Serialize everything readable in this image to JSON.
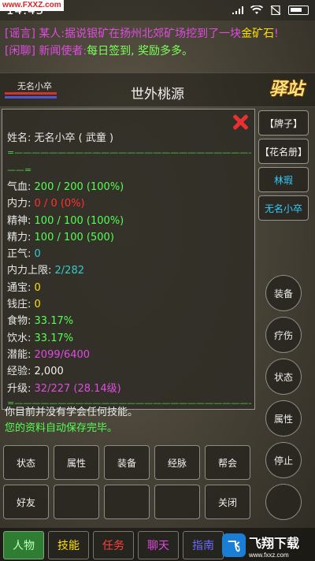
{
  "status_bar": {
    "time": "14:43",
    "watermark": "www.FXXZ.com"
  },
  "chat": [
    {
      "tag": "[谣言]",
      "sender": "某人:",
      "text": "据说银矿在扬州北郊矿场挖到了一块",
      "highlight": "金矿石",
      "end": "!"
    },
    {
      "tag": "[闲聊]",
      "sender": "新闻使者:",
      "text": "每日签到, 奖励多多。"
    }
  ],
  "header": {
    "player_name": "无名小卒",
    "location": "世外桃源",
    "inn_label": "驿站"
  },
  "panel": {
    "name_line": "姓名: 无名小卒 ( 武童 )",
    "divider1": "=——————————————————————————————————",
    "divider2": "——=",
    "stats": [
      {
        "label": "气血:",
        "value": "200 /   200 (100%)",
        "color": "g"
      },
      {
        "label": "内力:",
        "value": "0 /    0 (0%)",
        "color": "r"
      },
      {
        "label": "精神:",
        "value": "100 /   100 (100%)",
        "color": "g"
      },
      {
        "label": "精力:",
        "value": "100 /   100 (500)",
        "color": "g"
      },
      {
        "label": "正气:",
        "value": "0",
        "color": "c"
      },
      {
        "label": "内力上限:",
        "value": "2/282",
        "color": "c"
      },
      {
        "label": "通宝:",
        "value": "0",
        "color": "y"
      },
      {
        "label": "钱庄:",
        "value": "0",
        "color": "y"
      },
      {
        "label": "食物:",
        "value": "33.17%",
        "color": "g"
      },
      {
        "label": "饮水:",
        "value": "33.17%",
        "color": "g"
      },
      {
        "label": "潜能:",
        "value": "2099/6400",
        "color": "m"
      },
      {
        "label": "经验:",
        "value": "2,000",
        "color": "w"
      },
      {
        "label": "升级:",
        "value": "32/227 (28.14级)",
        "color": "m"
      }
    ],
    "divider3": "=——————————————————————————————————="
  },
  "bottom_msgs": {
    "line1": "你目前并没有学会任何技能。",
    "line2": "您的资料自动保存完毕。"
  },
  "side_rect_buttons": [
    "【牌子】",
    "【花名册】",
    "林瑕",
    "无名小卒"
  ],
  "side_circle_buttons": [
    "装备",
    "疗伤",
    "状态",
    "属性",
    "停止",
    ""
  ],
  "grid_row1": [
    "状态",
    "属性",
    "装备",
    "经脉",
    "帮会"
  ],
  "grid_row2": [
    "好友",
    "",
    "",
    "",
    "关闭"
  ],
  "tabs": [
    "人物",
    "技能",
    "任务",
    "聊天",
    "指南"
  ],
  "watermark2": {
    "logo": "飞",
    "title": "飞翔下载",
    "url": "www.fxxz.com"
  }
}
